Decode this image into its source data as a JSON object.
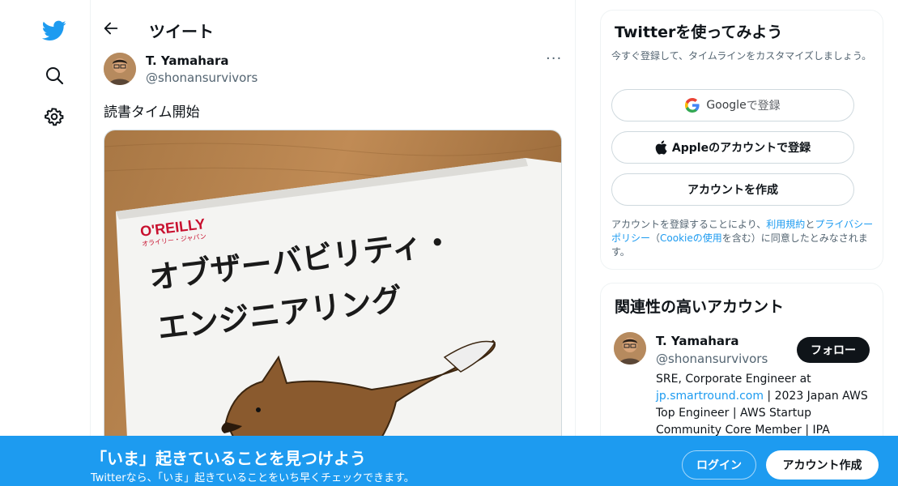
{
  "colors": {
    "brand": "#1d9bf0",
    "text": "#0f1419",
    "muted": "#536471"
  },
  "nav": {
    "icons": [
      "twitter-logo-icon",
      "search-icon",
      "gear-icon"
    ]
  },
  "header": {
    "title": "ツイート"
  },
  "tweet": {
    "author_name": "T. Yamahara",
    "author_handle": "@shonansurvivors",
    "more": "···",
    "text": "読書タイム開始",
    "image": {
      "publisher": "O'REILLY",
      "publisher_kana": "オライリー・ジャパン",
      "title_line1": "オブザーバビリティ・",
      "title_line2": "エンジニアリング"
    }
  },
  "signup_card": {
    "title": "Twitterを使ってみよう",
    "subtitle": "今すぐ登録して、タイムラインをカスタマイズしましょう。",
    "google_brand": "Google",
    "google_suffix": " で登録",
    "apple_label": "Appleのアカウントで登録",
    "create_label": "アカウントを作成",
    "legal_1": "アカウントを登録することにより、",
    "legal_terms": "利用規約",
    "legal_2": "と",
    "legal_privacy": "プライバシーポリシー",
    "legal_3": "（",
    "legal_cookie": "Cookieの使用",
    "legal_4": "を含む）に同意したとみなされます。"
  },
  "related": {
    "title": "関連性の高いアカウント",
    "name": "T. Yamahara",
    "handle": "@shonansurvivors",
    "follow_label": "フォロー",
    "bio_1": "SRE, Corporate Engineer at ",
    "bio_link": "jp.smartround.com",
    "bio_2": " | 2023 Japan AWS Top Engineer | AWS Startup Community Core Member | IPA"
  },
  "banner": {
    "title": "「いま」起きていることを見つけよう",
    "subtitle": "Twitterなら、「いま」起きていることをいち早くチェックできます。",
    "login_label": "ログイン",
    "signup_label": "アカウント作成"
  }
}
